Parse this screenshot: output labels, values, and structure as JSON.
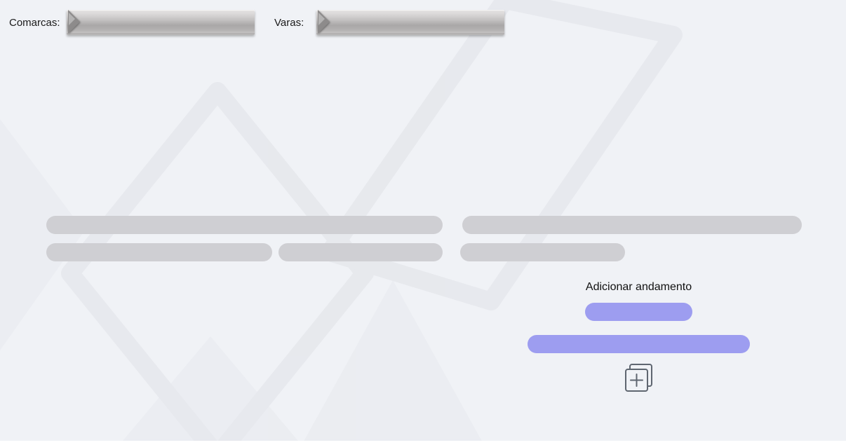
{
  "filters": {
    "comarcas_label": "Comarcas:",
    "varas_label": "Varas:"
  },
  "add_movement": {
    "title": "Adicionar andamento",
    "icon": "add-copy-icon"
  },
  "colors": {
    "background": "#f0f2f6",
    "skeleton": "#cfcfd3",
    "accent_pill": "#9d9df0",
    "icon_stroke": "#5f6670"
  }
}
